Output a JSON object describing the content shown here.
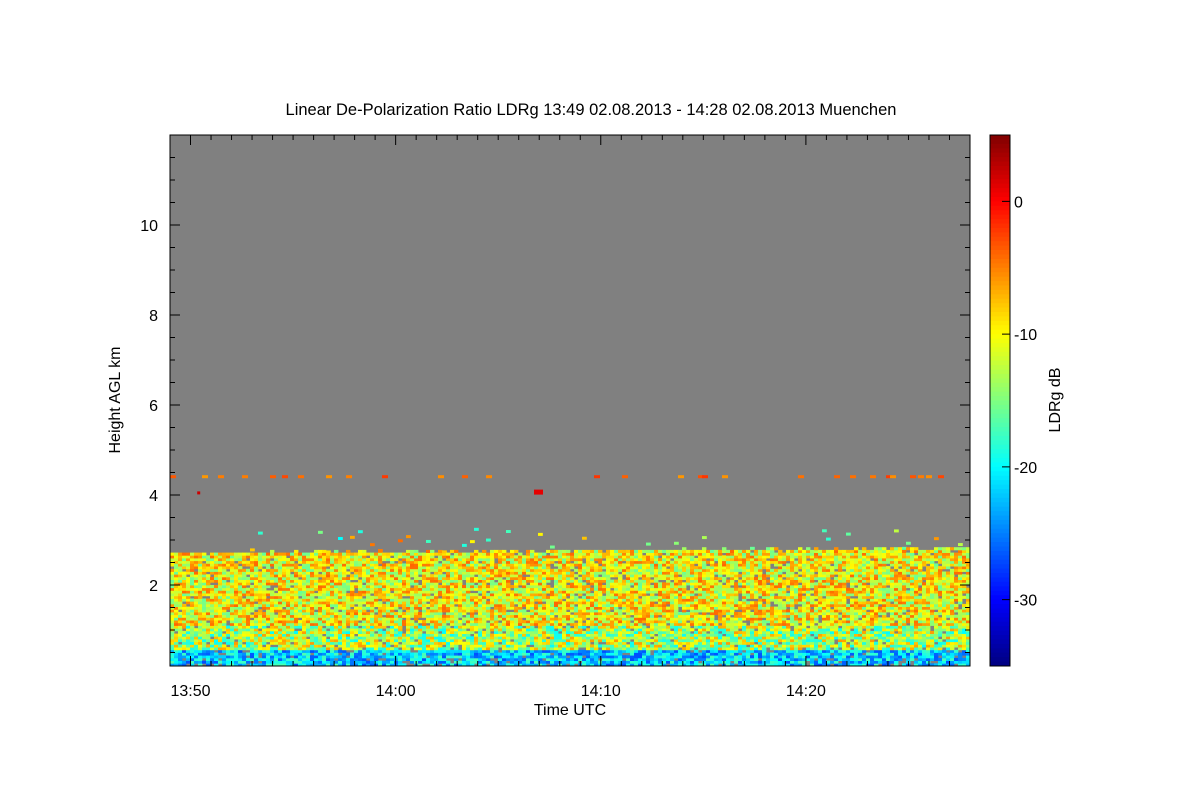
{
  "chart_data": {
    "type": "heatmap",
    "title": "Linear De-Polarization Ratio LDRg   13:49 02.08.2013 - 14:28 02.08.2013 Muenchen",
    "xlabel": "Time UTC",
    "ylabel": "Height AGL km",
    "x_ticks": [
      "13:50",
      "14:00",
      "14:10",
      "14:20"
    ],
    "y_ticks": [
      "2",
      "4",
      "6",
      "8",
      "10"
    ],
    "xlim": [
      "13:49",
      "14:28"
    ],
    "ylim": [
      0.2,
      12
    ],
    "colorbar": {
      "label": "LDRg dB",
      "ticks": [
        "0",
        "-10",
        "-20",
        "-30"
      ],
      "range": [
        -35,
        5
      ],
      "colormap": "jet"
    },
    "background_color": "#808080",
    "description_values": {
      "aerosol_layer_top_km": 2.8,
      "typical_ldr_db_in_layer": -10,
      "near_ground_ldr_db": -22,
      "sparse_cloud_height_km": 4.4
    }
  }
}
